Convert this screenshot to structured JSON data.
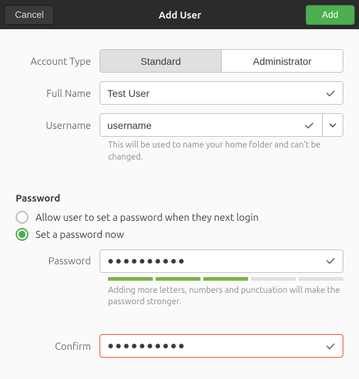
{
  "header": {
    "title": "Add User",
    "cancel": "Cancel",
    "add": "Add"
  },
  "labels": {
    "account_type": "Account Type",
    "full_name": "Full Name",
    "username": "Username",
    "username_hint": "This will be used to name your home folder and can't be changed.",
    "password_section": "Password",
    "radio_later": "Allow user to set a password when they next login",
    "radio_now": "Set a password now",
    "password": "Password",
    "password_hint": "Adding more letters, numbers and punctuation will make the password stronger.",
    "confirm": "Confirm"
  },
  "values": {
    "account_type_options": [
      "Standard",
      "Administrator"
    ],
    "account_type_selected": "Standard",
    "full_name": "Test User",
    "username": "username",
    "password": "●●●●●●●●●●",
    "confirm": "●●●●●●●●●●",
    "radio_selected": "now",
    "strength_segments_on": 3,
    "strength_segments_total": 5
  },
  "colors": {
    "accent_green": "#4caf50",
    "accent_orange": "#e95420"
  }
}
